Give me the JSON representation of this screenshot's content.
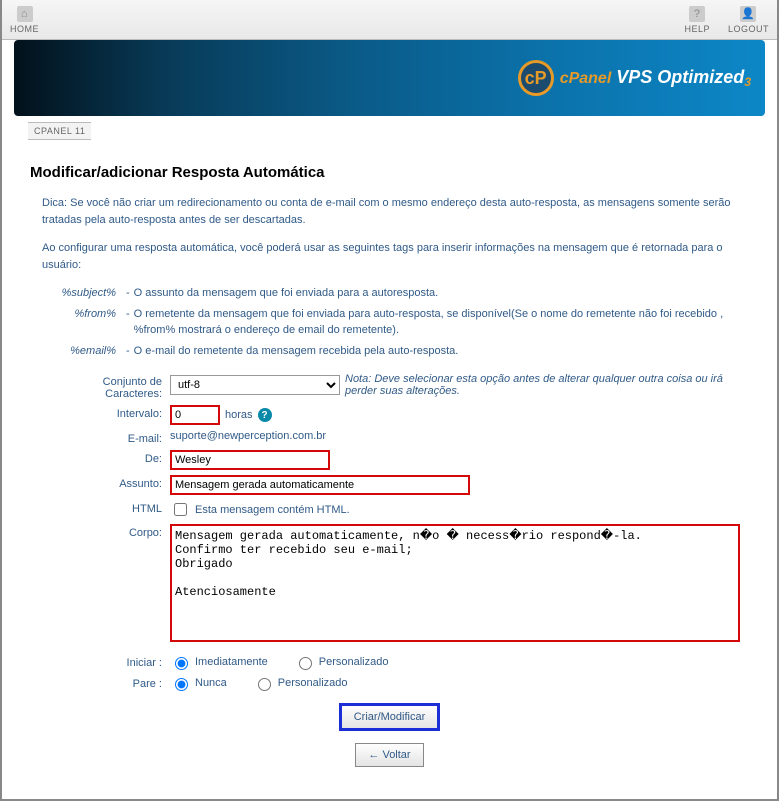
{
  "topbar": {
    "home": "HOME",
    "help": "HELP",
    "logout": "LOGOUT"
  },
  "banner": {
    "brand_orange": "cPanel",
    "brand_white": " VPS Optimized",
    "brand_sub": "3"
  },
  "crumb": "CPANEL 11",
  "page_title": "Modificar/adicionar Resposta Automática",
  "tip": "Dica: Se você não criar um redirecionamento ou conta de e-mail com o mesmo endereço desta auto-resposta, as mensagens somente serão tratadas pela auto-resposta antes de ser descartadas.",
  "intro": "Ao configurar uma resposta automática, você poderá usar as seguintes tags para inserir informações na mensagem que é retornada para o usuário:",
  "tags": [
    {
      "label": "%subject%",
      "desc": "O assunto da mensagem que foi enviada para a autoresposta."
    },
    {
      "label": "%from%",
      "desc": "O remetente da mensagem que foi enviada para auto-resposta, se disponível(Se o nome do remetente não foi recebido , %from% mostrará o endereço de email do remetente)."
    },
    {
      "label": "%email%",
      "desc": "O e-mail do remetente da mensagem recebida pela auto-resposta."
    }
  ],
  "form": {
    "charset_label": "Conjunto de Caracteres:",
    "charset_value": "utf-8",
    "charset_note": "Nota: Deve selecionar esta opção antes de alterar qualquer outra coisa ou irá perder suas alterações.",
    "interval_label": "Intervalo:",
    "interval_value": "0",
    "interval_unit": "horas",
    "email_label": "E-mail:",
    "email_value": "suporte@newperception.com.br",
    "from_label": "De:",
    "from_value": "Wesley",
    "subject_label": "Assunto:",
    "subject_value": "Mensagem gerada automaticamente",
    "html_label": "HTML",
    "html_check_label": "Esta mensagem contém HTML.",
    "body_label": "Corpo:",
    "body_value": "Mensagem gerada automaticamente, n�o � necess�rio respond�-la.\nConfirmo ter recebido seu e-mail;\nObrigado\n\nAtenciosamente",
    "start_label": "Iniciar :",
    "start_opt1": "Imediatamente",
    "start_opt2": "Personalizado",
    "stop_label": "Pare :",
    "stop_opt1": "Nunca",
    "stop_opt2": "Personalizado",
    "submit": "Criar/Modificar",
    "back": "← Voltar"
  }
}
